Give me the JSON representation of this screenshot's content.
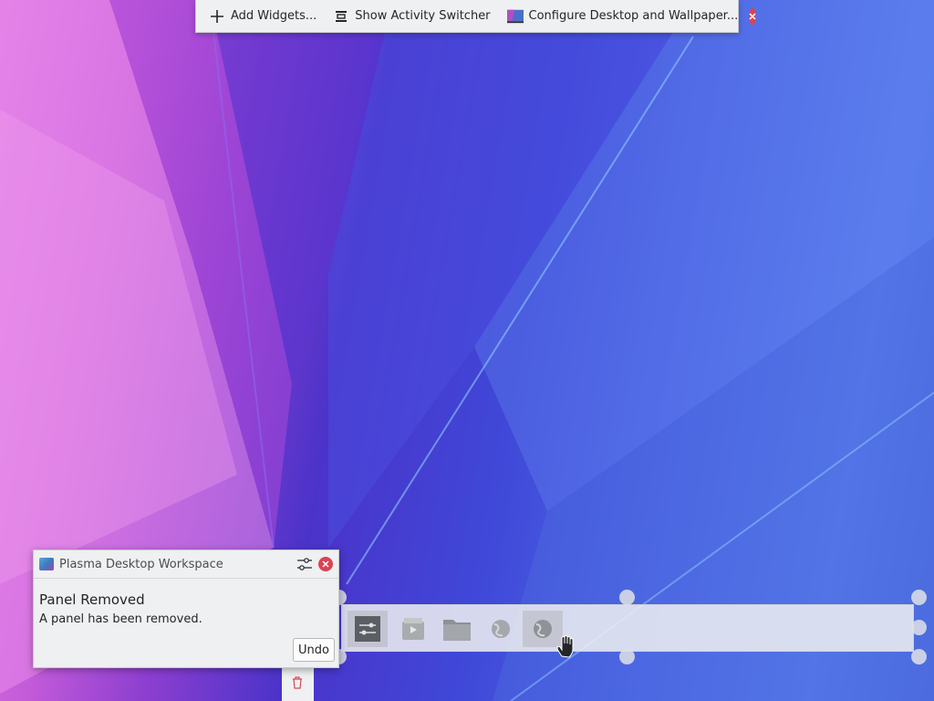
{
  "toolbar": {
    "add_widgets": "Add Widgets...",
    "activity_switcher": "Show Activity Switcher",
    "configure": "Configure Desktop and Wallpaper..."
  },
  "notification": {
    "app_name": "Plasma Desktop Workspace",
    "title": "Panel Removed",
    "body": "A panel has been removed.",
    "undo_label": "Undo"
  },
  "panel": {
    "tasks": [
      {
        "icon": "system-settings-icon",
        "active": true
      },
      {
        "icon": "software-center-icon",
        "active": false
      },
      {
        "icon": "folder-icon",
        "active": false
      },
      {
        "icon": "web-browser-icon",
        "active": false
      },
      {
        "icon": "web-browser-icon",
        "active": true
      }
    ]
  },
  "colors": {
    "accent_close": "#da4453",
    "toolbar_bg": "#eff0f1",
    "text": "#232629"
  }
}
